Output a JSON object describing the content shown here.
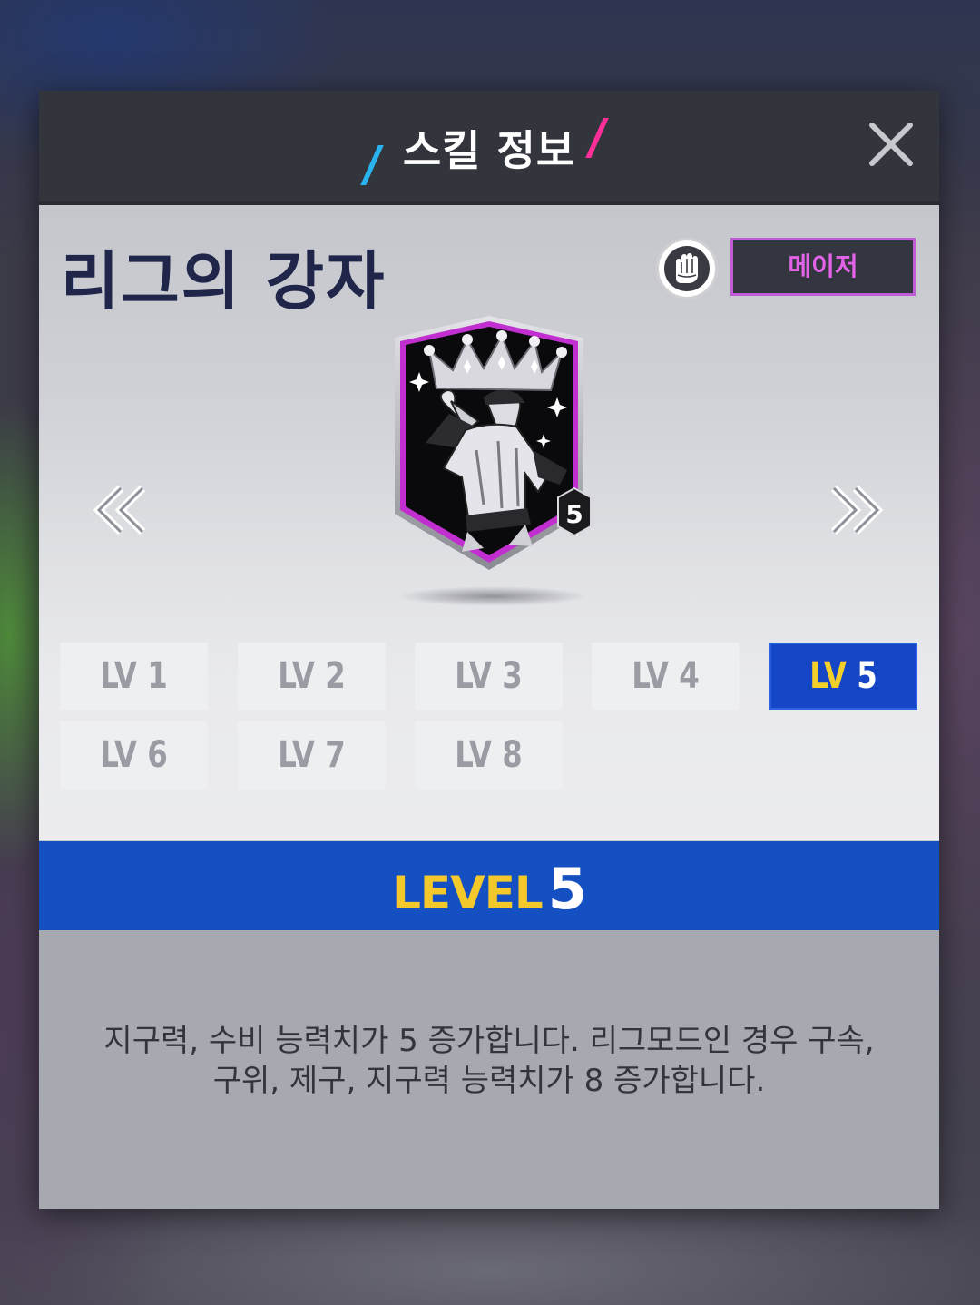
{
  "header": {
    "title": "스킬 정보",
    "close_icon": "close-icon"
  },
  "skill": {
    "name": "리그의 강자",
    "position_icon": "glove-icon",
    "grade": "메이저",
    "card_level": "5",
    "card_icon": "crowned-pitcher-icon"
  },
  "navigation": {
    "prev_icon": "double-chevron-left-icon",
    "next_icon": "double-chevron-right-icon"
  },
  "levels": [
    {
      "prefix": "LV",
      "num": "1",
      "active": false
    },
    {
      "prefix": "LV",
      "num": "2",
      "active": false
    },
    {
      "prefix": "LV",
      "num": "3",
      "active": false
    },
    {
      "prefix": "LV",
      "num": "4",
      "active": false
    },
    {
      "prefix": "LV",
      "num": "5",
      "active": true
    },
    {
      "prefix": "LV",
      "num": "6",
      "active": false
    },
    {
      "prefix": "LV",
      "num": "7",
      "active": false
    },
    {
      "prefix": "LV",
      "num": "8",
      "active": false
    }
  ],
  "selected_level": {
    "label": "LEVEL",
    "num": "5"
  },
  "description": {
    "line1": "지구력, 수비 능력치가 5 증가합니다. 리그모드인 경우 구속,",
    "line2": "구위, 제구, 지구력 능력치가 8 증가합니다."
  },
  "colors": {
    "header_bg": "#33353d",
    "accent_blue": "#1450c2",
    "level_gold": "#f3c82a",
    "grade_purple": "#c25bd6"
  }
}
